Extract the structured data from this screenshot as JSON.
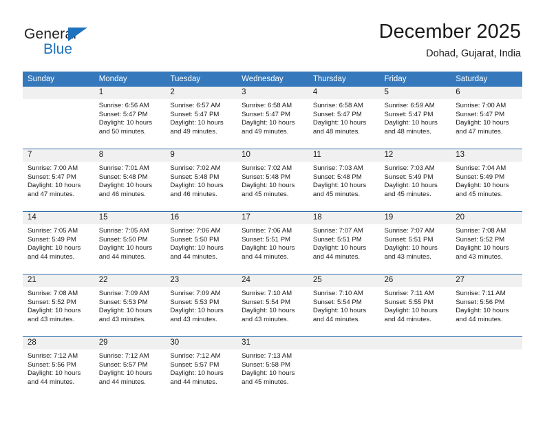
{
  "logo": {
    "word_top": "General",
    "word_bottom": "Blue",
    "triangle_icon": "triangle-icon",
    "accent_color": "#1f72bd"
  },
  "header": {
    "title": "December 2025",
    "subtitle": "Dohad, Gujarat, India"
  },
  "colors": {
    "header_row": "#3579bc",
    "day_number_band": "#f0f0f0",
    "week_separator": "#2f6fab",
    "text": "#1a1a1a"
  },
  "weekday_headers": [
    "Sunday",
    "Monday",
    "Tuesday",
    "Wednesday",
    "Thursday",
    "Friday",
    "Saturday"
  ],
  "weeks": [
    {
      "days": [
        {
          "number": "",
          "sunrise": "",
          "sunset": "",
          "daylight_line1": "",
          "daylight_line2": "",
          "empty": true
        },
        {
          "number": "1",
          "sunrise": "Sunrise: 6:56 AM",
          "sunset": "Sunset: 5:47 PM",
          "daylight_line1": "Daylight: 10 hours",
          "daylight_line2": "and 50 minutes.",
          "empty": false
        },
        {
          "number": "2",
          "sunrise": "Sunrise: 6:57 AM",
          "sunset": "Sunset: 5:47 PM",
          "daylight_line1": "Daylight: 10 hours",
          "daylight_line2": "and 49 minutes.",
          "empty": false
        },
        {
          "number": "3",
          "sunrise": "Sunrise: 6:58 AM",
          "sunset": "Sunset: 5:47 PM",
          "daylight_line1": "Daylight: 10 hours",
          "daylight_line2": "and 49 minutes.",
          "empty": false
        },
        {
          "number": "4",
          "sunrise": "Sunrise: 6:58 AM",
          "sunset": "Sunset: 5:47 PM",
          "daylight_line1": "Daylight: 10 hours",
          "daylight_line2": "and 48 minutes.",
          "empty": false
        },
        {
          "number": "5",
          "sunrise": "Sunrise: 6:59 AM",
          "sunset": "Sunset: 5:47 PM",
          "daylight_line1": "Daylight: 10 hours",
          "daylight_line2": "and 48 minutes.",
          "empty": false
        },
        {
          "number": "6",
          "sunrise": "Sunrise: 7:00 AM",
          "sunset": "Sunset: 5:47 PM",
          "daylight_line1": "Daylight: 10 hours",
          "daylight_line2": "and 47 minutes.",
          "empty": false
        }
      ]
    },
    {
      "days": [
        {
          "number": "7",
          "sunrise": "Sunrise: 7:00 AM",
          "sunset": "Sunset: 5:47 PM",
          "daylight_line1": "Daylight: 10 hours",
          "daylight_line2": "and 47 minutes.",
          "empty": false
        },
        {
          "number": "8",
          "sunrise": "Sunrise: 7:01 AM",
          "sunset": "Sunset: 5:48 PM",
          "daylight_line1": "Daylight: 10 hours",
          "daylight_line2": "and 46 minutes.",
          "empty": false
        },
        {
          "number": "9",
          "sunrise": "Sunrise: 7:02 AM",
          "sunset": "Sunset: 5:48 PM",
          "daylight_line1": "Daylight: 10 hours",
          "daylight_line2": "and 46 minutes.",
          "empty": false
        },
        {
          "number": "10",
          "sunrise": "Sunrise: 7:02 AM",
          "sunset": "Sunset: 5:48 PM",
          "daylight_line1": "Daylight: 10 hours",
          "daylight_line2": "and 45 minutes.",
          "empty": false
        },
        {
          "number": "11",
          "sunrise": "Sunrise: 7:03 AM",
          "sunset": "Sunset: 5:48 PM",
          "daylight_line1": "Daylight: 10 hours",
          "daylight_line2": "and 45 minutes.",
          "empty": false
        },
        {
          "number": "12",
          "sunrise": "Sunrise: 7:03 AM",
          "sunset": "Sunset: 5:49 PM",
          "daylight_line1": "Daylight: 10 hours",
          "daylight_line2": "and 45 minutes.",
          "empty": false
        },
        {
          "number": "13",
          "sunrise": "Sunrise: 7:04 AM",
          "sunset": "Sunset: 5:49 PM",
          "daylight_line1": "Daylight: 10 hours",
          "daylight_line2": "and 45 minutes.",
          "empty": false
        }
      ]
    },
    {
      "days": [
        {
          "number": "14",
          "sunrise": "Sunrise: 7:05 AM",
          "sunset": "Sunset: 5:49 PM",
          "daylight_line1": "Daylight: 10 hours",
          "daylight_line2": "and 44 minutes.",
          "empty": false
        },
        {
          "number": "15",
          "sunrise": "Sunrise: 7:05 AM",
          "sunset": "Sunset: 5:50 PM",
          "daylight_line1": "Daylight: 10 hours",
          "daylight_line2": "and 44 minutes.",
          "empty": false
        },
        {
          "number": "16",
          "sunrise": "Sunrise: 7:06 AM",
          "sunset": "Sunset: 5:50 PM",
          "daylight_line1": "Daylight: 10 hours",
          "daylight_line2": "and 44 minutes.",
          "empty": false
        },
        {
          "number": "17",
          "sunrise": "Sunrise: 7:06 AM",
          "sunset": "Sunset: 5:51 PM",
          "daylight_line1": "Daylight: 10 hours",
          "daylight_line2": "and 44 minutes.",
          "empty": false
        },
        {
          "number": "18",
          "sunrise": "Sunrise: 7:07 AM",
          "sunset": "Sunset: 5:51 PM",
          "daylight_line1": "Daylight: 10 hours",
          "daylight_line2": "and 44 minutes.",
          "empty": false
        },
        {
          "number": "19",
          "sunrise": "Sunrise: 7:07 AM",
          "sunset": "Sunset: 5:51 PM",
          "daylight_line1": "Daylight: 10 hours",
          "daylight_line2": "and 43 minutes.",
          "empty": false
        },
        {
          "number": "20",
          "sunrise": "Sunrise: 7:08 AM",
          "sunset": "Sunset: 5:52 PM",
          "daylight_line1": "Daylight: 10 hours",
          "daylight_line2": "and 43 minutes.",
          "empty": false
        }
      ]
    },
    {
      "days": [
        {
          "number": "21",
          "sunrise": "Sunrise: 7:08 AM",
          "sunset": "Sunset: 5:52 PM",
          "daylight_line1": "Daylight: 10 hours",
          "daylight_line2": "and 43 minutes.",
          "empty": false
        },
        {
          "number": "22",
          "sunrise": "Sunrise: 7:09 AM",
          "sunset": "Sunset: 5:53 PM",
          "daylight_line1": "Daylight: 10 hours",
          "daylight_line2": "and 43 minutes.",
          "empty": false
        },
        {
          "number": "23",
          "sunrise": "Sunrise: 7:09 AM",
          "sunset": "Sunset: 5:53 PM",
          "daylight_line1": "Daylight: 10 hours",
          "daylight_line2": "and 43 minutes.",
          "empty": false
        },
        {
          "number": "24",
          "sunrise": "Sunrise: 7:10 AM",
          "sunset": "Sunset: 5:54 PM",
          "daylight_line1": "Daylight: 10 hours",
          "daylight_line2": "and 43 minutes.",
          "empty": false
        },
        {
          "number": "25",
          "sunrise": "Sunrise: 7:10 AM",
          "sunset": "Sunset: 5:54 PM",
          "daylight_line1": "Daylight: 10 hours",
          "daylight_line2": "and 44 minutes.",
          "empty": false
        },
        {
          "number": "26",
          "sunrise": "Sunrise: 7:11 AM",
          "sunset": "Sunset: 5:55 PM",
          "daylight_line1": "Daylight: 10 hours",
          "daylight_line2": "and 44 minutes.",
          "empty": false
        },
        {
          "number": "27",
          "sunrise": "Sunrise: 7:11 AM",
          "sunset": "Sunset: 5:56 PM",
          "daylight_line1": "Daylight: 10 hours",
          "daylight_line2": "and 44 minutes.",
          "empty": false
        }
      ]
    },
    {
      "days": [
        {
          "number": "28",
          "sunrise": "Sunrise: 7:12 AM",
          "sunset": "Sunset: 5:56 PM",
          "daylight_line1": "Daylight: 10 hours",
          "daylight_line2": "and 44 minutes.",
          "empty": false
        },
        {
          "number": "29",
          "sunrise": "Sunrise: 7:12 AM",
          "sunset": "Sunset: 5:57 PM",
          "daylight_line1": "Daylight: 10 hours",
          "daylight_line2": "and 44 minutes.",
          "empty": false
        },
        {
          "number": "30",
          "sunrise": "Sunrise: 7:12 AM",
          "sunset": "Sunset: 5:57 PM",
          "daylight_line1": "Daylight: 10 hours",
          "daylight_line2": "and 44 minutes.",
          "empty": false
        },
        {
          "number": "31",
          "sunrise": "Sunrise: 7:13 AM",
          "sunset": "Sunset: 5:58 PM",
          "daylight_line1": "Daylight: 10 hours",
          "daylight_line2": "and 45 minutes.",
          "empty": false
        },
        {
          "number": "",
          "sunrise": "",
          "sunset": "",
          "daylight_line1": "",
          "daylight_line2": "",
          "empty": true
        },
        {
          "number": "",
          "sunrise": "",
          "sunset": "",
          "daylight_line1": "",
          "daylight_line2": "",
          "empty": true
        },
        {
          "number": "",
          "sunrise": "",
          "sunset": "",
          "daylight_line1": "",
          "daylight_line2": "",
          "empty": true
        }
      ]
    }
  ]
}
